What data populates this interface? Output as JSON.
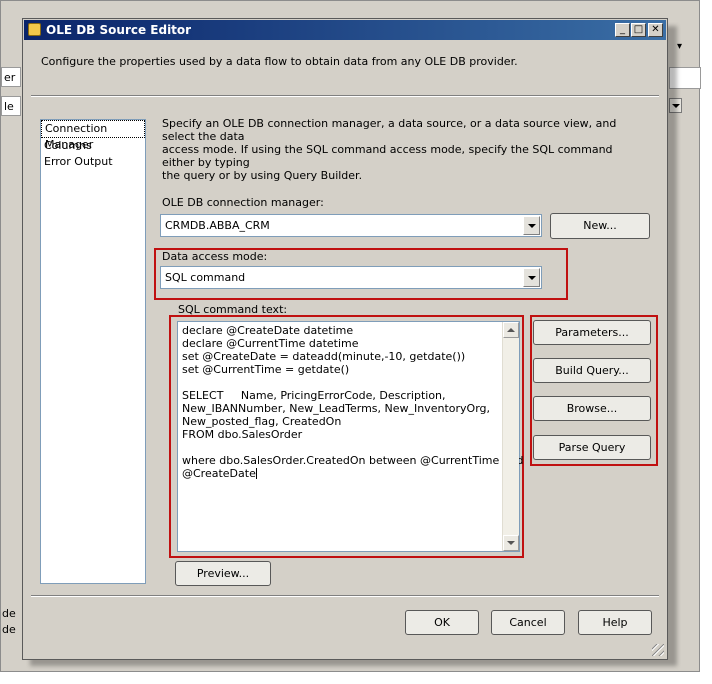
{
  "dialog": {
    "title": "OLE DB Source Editor",
    "description": "Configure the properties used by a data flow to obtain data from any OLE DB provider.",
    "title_buttons": {
      "minimize": "_",
      "maximize": "□",
      "close": "✕"
    }
  },
  "nav": {
    "items": [
      "Connection Manager",
      "Columns",
      "Error Output"
    ],
    "selected": "Connection Manager"
  },
  "info": {
    "lines": [
      "Specify an OLE DB connection manager, a data source, or a data source view, and select the data",
      "access mode. If using the SQL command access mode, specify the SQL command either by typing",
      "the query or by using Query Builder."
    ]
  },
  "connection": {
    "label": "OLE DB connection manager:",
    "value": "CRMDB.ABBA_CRM",
    "new_button": "New..."
  },
  "access_mode": {
    "label": "Data access mode:",
    "value": "SQL command"
  },
  "sql": {
    "label": "SQL command text:",
    "lines": [
      "declare @CreateDate datetime",
      "declare @CurrentTime datetime",
      "set @CreateDate = dateadd(minute,-10, getdate())",
      "set @CurrentTime = getdate()",
      "",
      "SELECT     Name, PricingErrorCode, Description,",
      "New_IBANNumber, New_LeadTerms, New_InventoryOrg,",
      "New_posted_flag, CreatedOn",
      "FROM dbo.SalesOrder",
      "",
      "where dbo.SalesOrder.CreatedOn between @CurrentTime and",
      "@CreateDate"
    ]
  },
  "side_buttons": {
    "parameters": "Parameters...",
    "build_query": "Build Query...",
    "browse": "Browse...",
    "parse_query": "Parse Query"
  },
  "preview_button": "Preview...",
  "footer": {
    "ok": "OK",
    "cancel": "Cancel",
    "help": "Help"
  },
  "background": {
    "frag_top": "er",
    "frag_mid": "le",
    "frag_bottom1": "de",
    "frag_bottom2": "de"
  },
  "colors": {
    "titlebar": "#0a246a",
    "highlight_box": "#c01010",
    "dialog_face": "#d4d0c8"
  }
}
